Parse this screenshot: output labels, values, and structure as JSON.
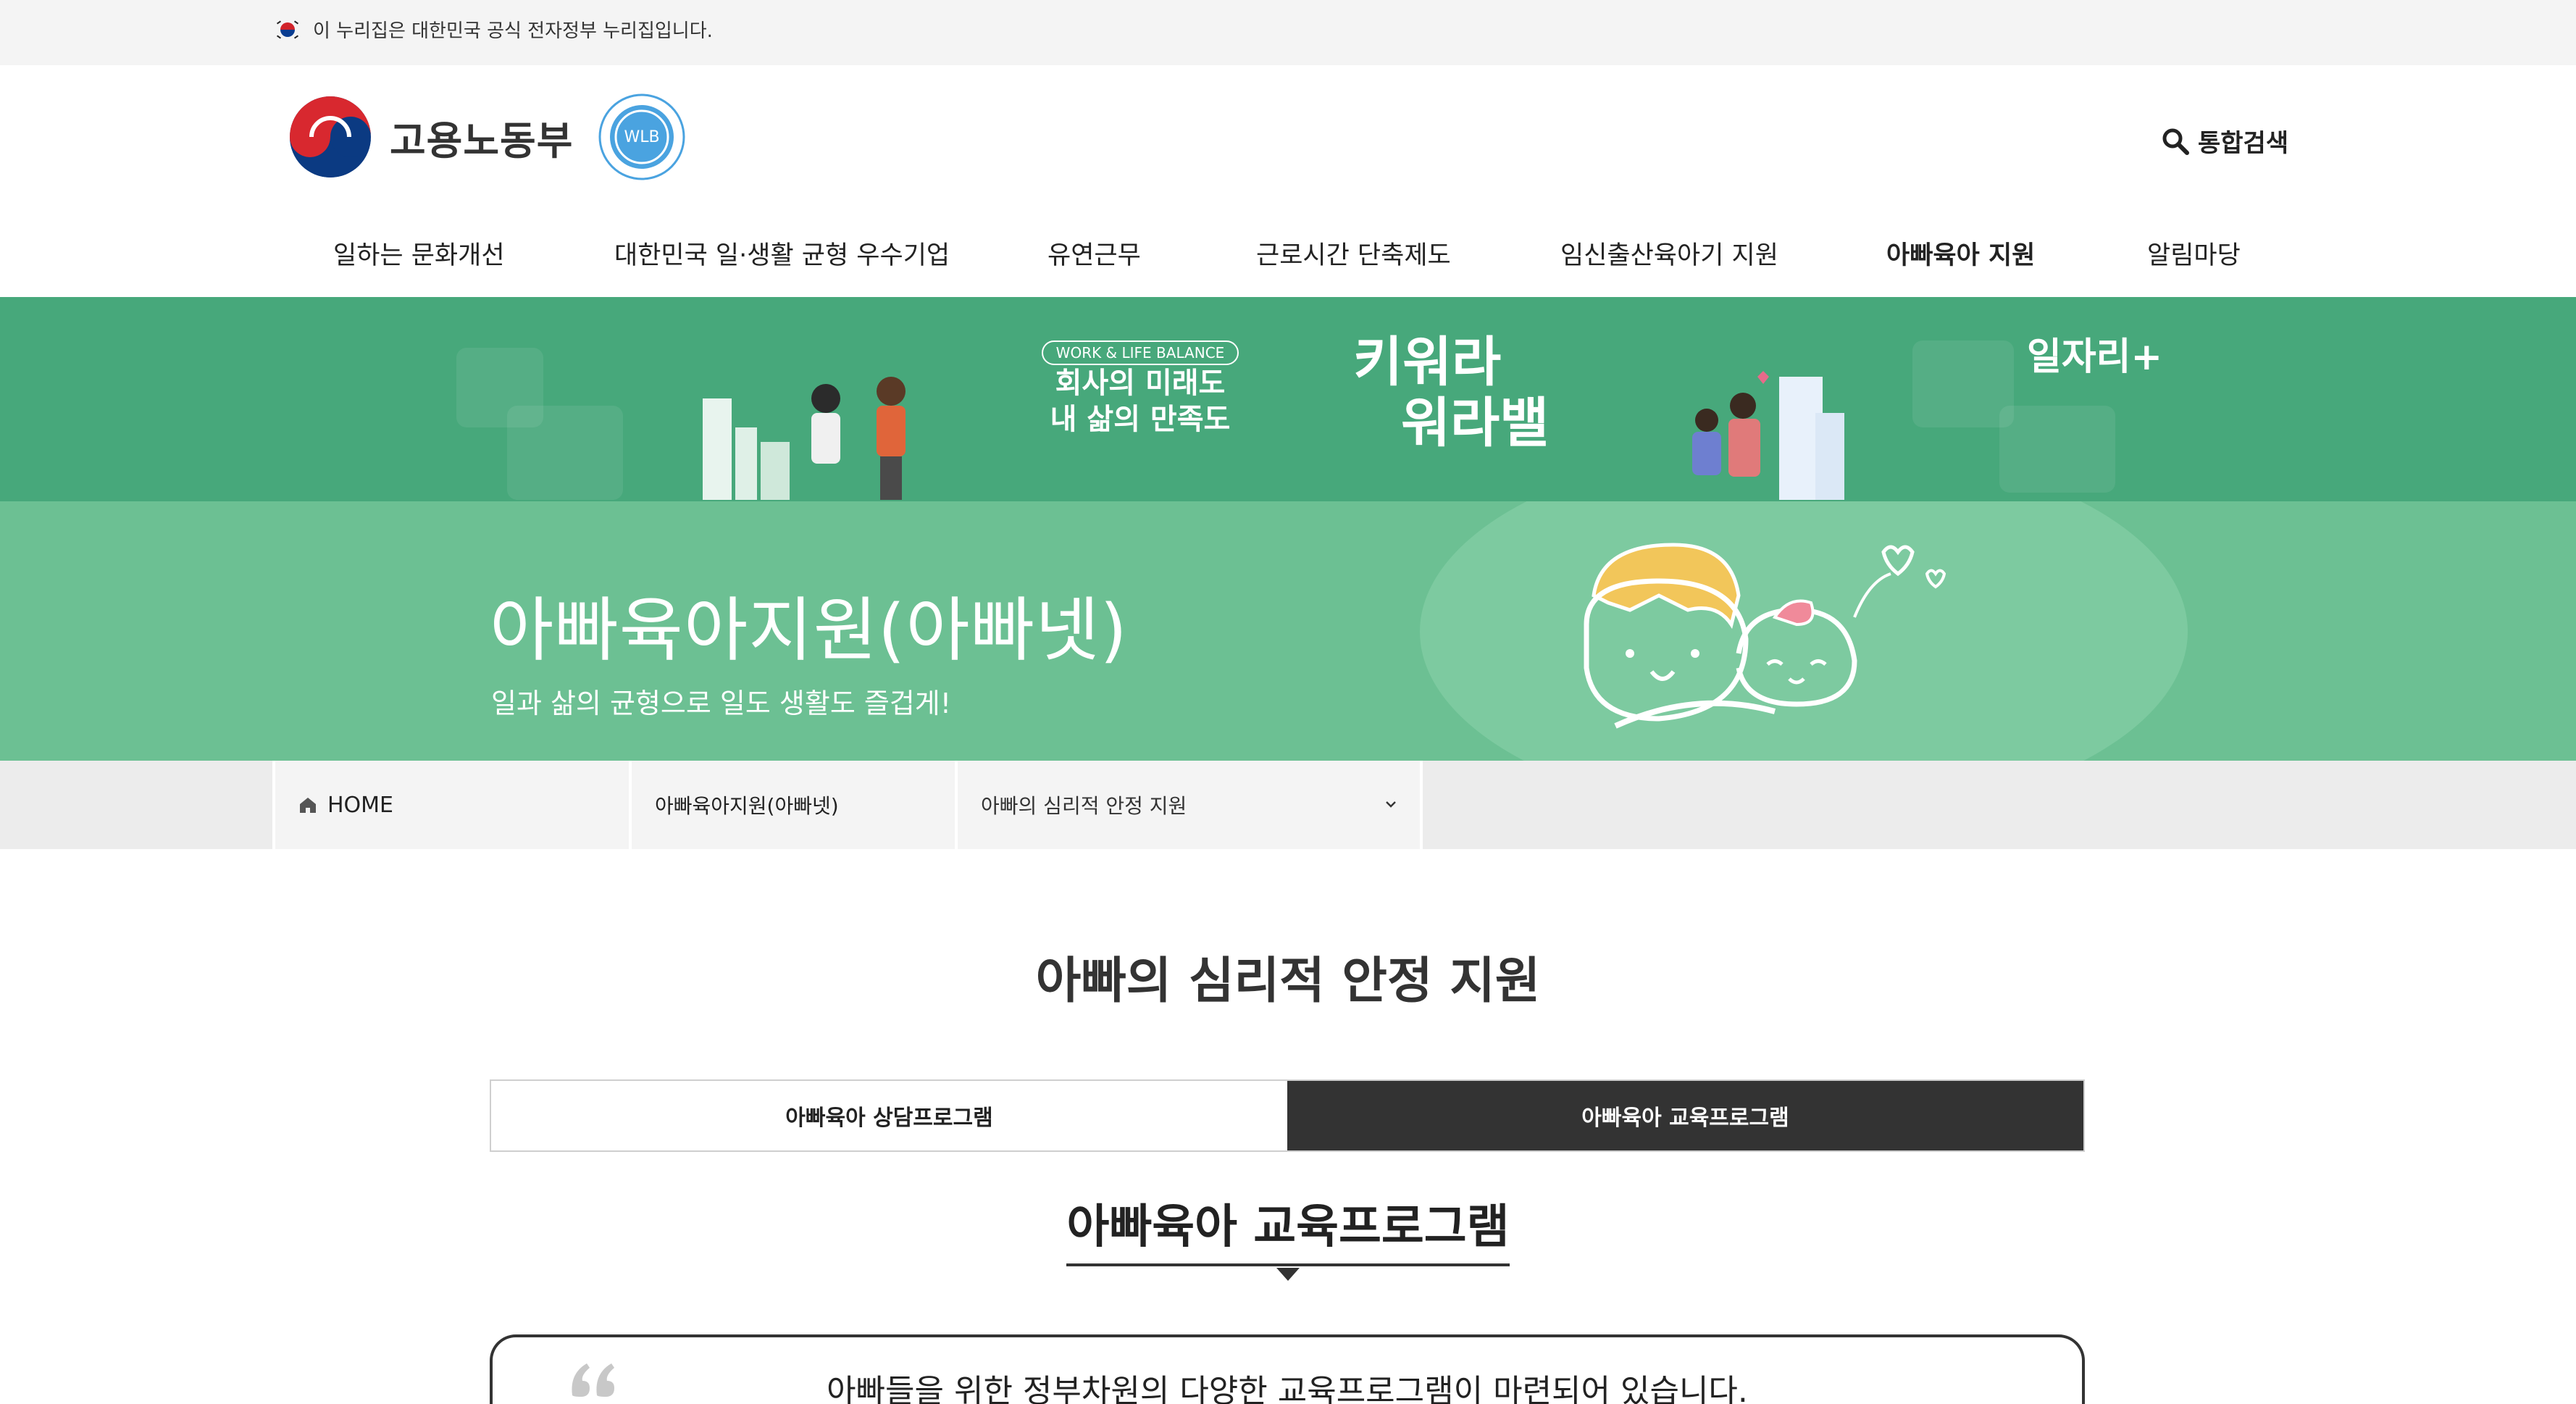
{
  "gov_banner": {
    "text": "이 누리집은 대한민국 공식 전자정부 누리집입니다."
  },
  "header": {
    "ministry_name": "고용노동부",
    "search_label": "통합검색",
    "wlb_badge": "WLB"
  },
  "gnb": [
    {
      "label": "일하는 문화개선",
      "active": false
    },
    {
      "label": "대한민국 일·생활 균형 우수기업",
      "active": false
    },
    {
      "label": "유연근무",
      "active": false
    },
    {
      "label": "근로시간 단축제도",
      "active": false
    },
    {
      "label": "임신출산육아기 지원",
      "active": false
    },
    {
      "label": "아빠육아 지원",
      "active": true
    },
    {
      "label": "알림마당",
      "active": false
    }
  ],
  "promo": {
    "slogan_tag": "WORK & LIFE BALANCE",
    "slogan_line1": "회사의 미래도",
    "slogan_line2": "내 삶의 만족도",
    "kiwora_line1": "키워라",
    "kiwora_line2": "워라밸",
    "jobplus": "일자리+"
  },
  "hero": {
    "title": "아빠육아지원(아빠넷)",
    "subtitle": "일과 삶의 균형으로 일도 생활도 즐겁게!"
  },
  "location": {
    "home": "HOME",
    "depth1": "아빠육아지원(아빠넷)",
    "depth2": "아빠의 심리적 안정 지원"
  },
  "content": {
    "page_title": "아빠의 심리적 안정 지원",
    "tabs": [
      {
        "label": "아빠육아 상담프로그램",
        "active": false
      },
      {
        "label": "아빠육아 교육프로그램",
        "active": true
      }
    ],
    "section_title": "아빠육아 교육프로그램",
    "intro": "아빠들을 위한 정부차원의 다양한 교육프로그램이 마련되어 있습니다."
  },
  "colors": {
    "promo_bg": "#47a87b",
    "hero_bg": "#6cc093",
    "tab_active_bg": "#333333"
  }
}
